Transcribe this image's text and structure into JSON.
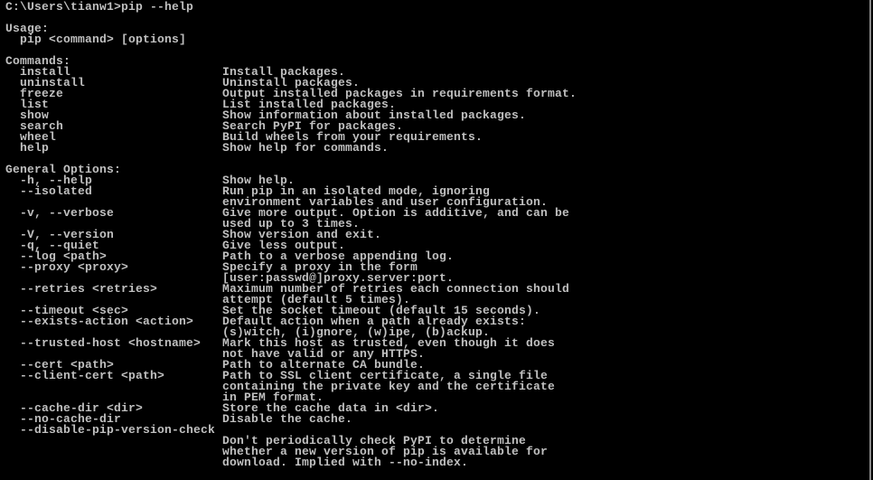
{
  "window": {
    "type": "command-prompt",
    "text_color": "#c0c0c0",
    "background": "#000000"
  },
  "prompt": "C:\\Users\\tianw1>pip --help",
  "lines": [
    [
      "",
      ""
    ],
    [
      "Usage:",
      ""
    ],
    [
      "  pip <command> [options]",
      ""
    ],
    [
      "",
      ""
    ],
    [
      "Commands:",
      ""
    ],
    [
      "  install",
      "Install packages."
    ],
    [
      "  uninstall",
      "Uninstall packages."
    ],
    [
      "  freeze",
      "Output installed packages in requirements format."
    ],
    [
      "  list",
      "List installed packages."
    ],
    [
      "  show",
      "Show information about installed packages."
    ],
    [
      "  search",
      "Search PyPI for packages."
    ],
    [
      "  wheel",
      "Build wheels from your requirements."
    ],
    [
      "  help",
      "Show help for commands."
    ],
    [
      "",
      ""
    ],
    [
      "General Options:",
      ""
    ],
    [
      "  -h, --help",
      "Show help."
    ],
    [
      "  --isolated",
      "Run pip in an isolated mode, ignoring"
    ],
    [
      "",
      "environment variables and user configuration."
    ],
    [
      "  -v, --verbose",
      "Give more output. Option is additive, and can be"
    ],
    [
      "",
      "used up to 3 times."
    ],
    [
      "  -V, --version",
      "Show version and exit."
    ],
    [
      "  -q, --quiet",
      "Give less output."
    ],
    [
      "  --log <path>",
      "Path to a verbose appending log."
    ],
    [
      "  --proxy <proxy>",
      "Specify a proxy in the form"
    ],
    [
      "",
      "[user:passwd@]proxy.server:port."
    ],
    [
      "  --retries <retries>",
      "Maximum number of retries each connection should"
    ],
    [
      "",
      "attempt (default 5 times)."
    ],
    [
      "  --timeout <sec>",
      "Set the socket timeout (default 15 seconds)."
    ],
    [
      "  --exists-action <action>",
      "Default action when a path already exists:"
    ],
    [
      "",
      "(s)witch, (i)gnore, (w)ipe, (b)ackup."
    ],
    [
      "  --trusted-host <hostname>",
      "Mark this host as trusted, even though it does"
    ],
    [
      "",
      "not have valid or any HTTPS."
    ],
    [
      "  --cert <path>",
      "Path to alternate CA bundle."
    ],
    [
      "  --client-cert <path>",
      "Path to SSL client certificate, a single file"
    ],
    [
      "",
      "containing the private key and the certificate"
    ],
    [
      "",
      "in PEM format."
    ],
    [
      "  --cache-dir <dir>",
      "Store the cache data in <dir>."
    ],
    [
      "  --no-cache-dir",
      "Disable the cache."
    ],
    [
      "  --disable-pip-version-check",
      ""
    ],
    [
      "",
      "Don't periodically check PyPI to determine"
    ],
    [
      "",
      "whether a new version of pip is available for"
    ],
    [
      "",
      "download. Implied with --no-index."
    ]
  ]
}
